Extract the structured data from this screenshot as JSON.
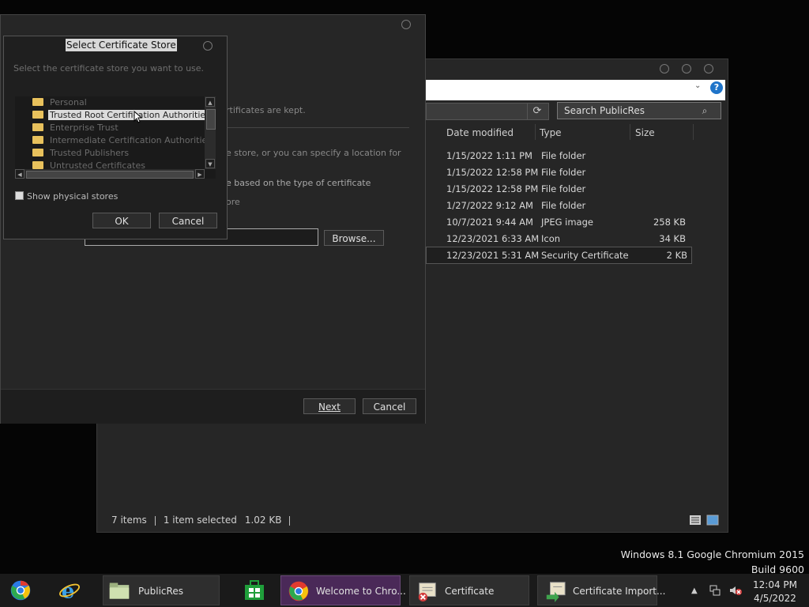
{
  "explorer": {
    "search_placeholder": "Search PublicRes",
    "refresh_glyph": "⟳",
    "search_glyph": "⌕",
    "help_glyph": "?",
    "columns": {
      "date": "Date modified",
      "type": "Type",
      "size": "Size"
    },
    "rows": [
      {
        "date": "1/15/2022 1:11 PM",
        "type": "File folder",
        "size": ""
      },
      {
        "date": "1/15/2022 12:58 PM",
        "type": "File folder",
        "size": ""
      },
      {
        "date": "1/15/2022 12:58 PM",
        "type": "File folder",
        "size": ""
      },
      {
        "date": "1/27/2022 9:12 AM",
        "type": "File folder",
        "size": ""
      },
      {
        "date": "10/7/2021 9:44 AM",
        "type": "JPEG image",
        "size": "258 KB"
      },
      {
        "date": "12/23/2021 6:33 AM",
        "type": "Icon",
        "size": "34 KB"
      },
      {
        "date": "12/23/2021 5:31 AM",
        "type": "Security Certificate",
        "size": "2 KB"
      }
    ],
    "status": {
      "items": "7 items",
      "selected": "1 item selected",
      "size": "1.02 KB"
    }
  },
  "wizard": {
    "frag_keep": "rtificates are kept.",
    "frag_store": "e store, or you can specify a location for",
    "frag_type": "e based on the type of certificate",
    "frag_ore": "ore",
    "browse": "Browse...",
    "next": "Next",
    "cancel": "Cancel"
  },
  "dialog": {
    "title": "Select Certificate Store",
    "instructions": "Select the certificate store you want to use.",
    "stores": [
      "Personal",
      "Trusted Root Certification Authorities",
      "Enterprise Trust",
      "Intermediate Certification Authorities",
      "Trusted Publishers",
      "Untrusted Certificates"
    ],
    "selected_store": "Trusted Root Certification Authorities",
    "show_physical": "Show physical stores",
    "ok": "OK",
    "cancel": "Cancel"
  },
  "watermark": {
    "line1": "Windows 8.1 Google Chromium 2015",
    "line2": "Build 9600"
  },
  "taskbar": {
    "items": [
      {
        "title": "PublicRes",
        "icon": "folder-icon"
      },
      {
        "title": "Welcome to Chro...",
        "icon": "chrome-icon"
      },
      {
        "title": "Certificate",
        "icon": "certificate-icon"
      },
      {
        "title": "Certificate Import...",
        "icon": "certificate-import-icon"
      }
    ],
    "time": "12:04 PM",
    "date": "4/5/2022",
    "tray_arrow": "▲"
  },
  "colors": {
    "taskbar_active": "#4a2958",
    "help_blue": "#1f74c9",
    "folder": "#e8c15c"
  }
}
